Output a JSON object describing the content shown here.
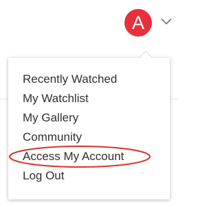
{
  "account": {
    "avatar_letter": "A",
    "avatar_color": "#e8303b",
    "chevron_icon": "chevron-down-icon"
  },
  "menu": {
    "items": [
      {
        "label": "Recently Watched"
      },
      {
        "label": "My Watchlist"
      },
      {
        "label": "My Gallery"
      },
      {
        "label": "Community"
      },
      {
        "label": "Access My Account"
      },
      {
        "label": "Log Out"
      }
    ]
  },
  "annotation": {
    "highlight_color": "#d8312b",
    "highlighted_item": "Access My Account"
  }
}
